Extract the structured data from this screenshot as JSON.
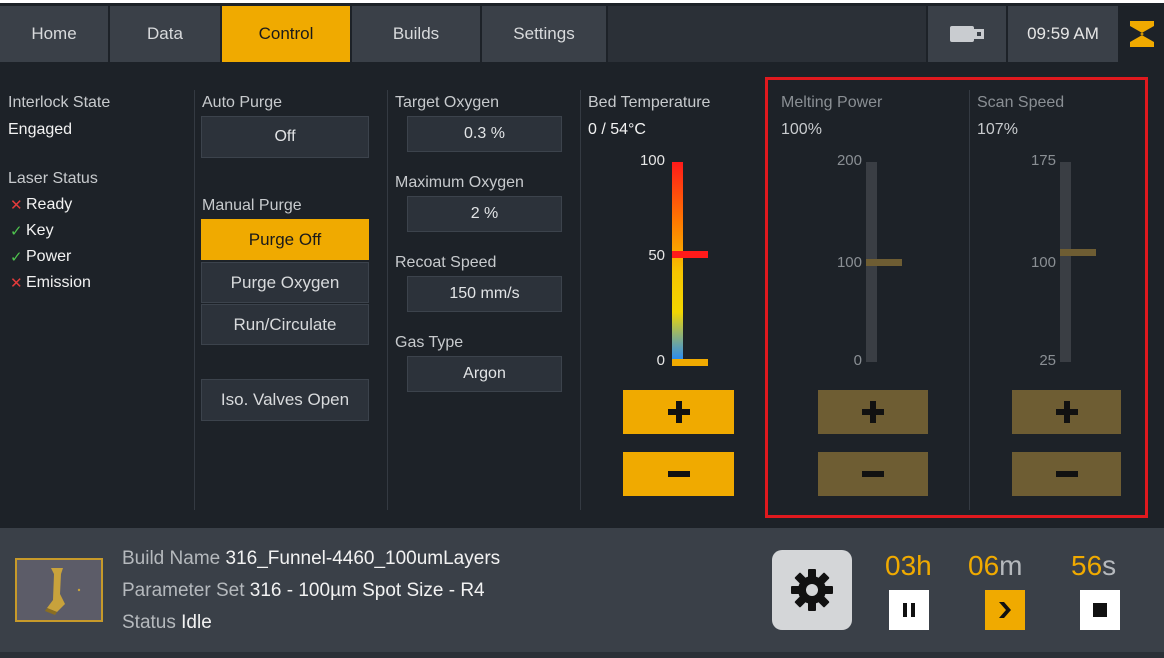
{
  "nav": {
    "tabs": [
      {
        "label": "Home"
      },
      {
        "label": "Data"
      },
      {
        "label": "Control"
      },
      {
        "label": "Builds"
      },
      {
        "label": "Settings"
      }
    ],
    "active": "Control",
    "time": "09:59 AM",
    "icons": {
      "usb": "usb-drive-icon",
      "logo": "brand-logo-icon"
    }
  },
  "interlock": {
    "label": "Interlock State",
    "value": "Engaged"
  },
  "laser": {
    "label": "Laser Status",
    "items": [
      {
        "mark": "✕",
        "state": "error",
        "label": "Ready"
      },
      {
        "mark": "✓",
        "state": "ok",
        "label": "Key"
      },
      {
        "mark": "✓",
        "state": "ok",
        "label": "Power"
      },
      {
        "mark": "✕",
        "state": "error",
        "label": "Emission"
      }
    ]
  },
  "purge": {
    "auto_label": "Auto Purge",
    "auto_value": "Off",
    "manual_label": "Manual Purge",
    "manual_options": [
      "Purge Off",
      "Purge Oxygen",
      "Run/Circulate"
    ],
    "manual_selected": "Purge Off",
    "iso_valves": "Iso. Valves Open"
  },
  "gas": {
    "target_oxygen_label": "Target Oxygen",
    "target_oxygen_value": "0.3 %",
    "max_oxygen_label": "Maximum Oxygen",
    "max_oxygen_value": "2 %",
    "recoat_label": "Recoat Speed",
    "recoat_value": "150 mm/s",
    "gas_type_label": "Gas Type",
    "gas_type_value": "Argon"
  },
  "bed": {
    "label": "Bed Temperature",
    "value": "0 / 54°C",
    "ticks": [
      "100",
      "50",
      "0"
    ],
    "range": [
      0,
      100
    ],
    "current": 0,
    "setpoint": 54
  },
  "melting": {
    "label": "Melting Power",
    "value": "100%",
    "ticks": [
      "200",
      "100",
      "0"
    ],
    "range": [
      0,
      200
    ],
    "level": 100
  },
  "scan": {
    "label": "Scan Speed",
    "value": "107%",
    "ticks": [
      "175",
      "100",
      "25"
    ],
    "range": [
      25,
      175
    ],
    "level": 107
  },
  "build": {
    "name_label": "Build Name",
    "name_value": "316_Funnel-4460_100umLayers",
    "param_label": "Parameter Set",
    "param_value": "316 - 100µm Spot Size - R4",
    "status_label": "Status",
    "status_value": "Idle"
  },
  "timer": {
    "hours": "03",
    "hours_unit": "h",
    "minutes": "06",
    "minutes_unit": "m",
    "seconds": "56",
    "seconds_unit": "s"
  },
  "colors": {
    "accent": "#f0aa00",
    "highlight": "#e0191e",
    "error": "#e33b3b",
    "ok": "#4ec24e"
  }
}
